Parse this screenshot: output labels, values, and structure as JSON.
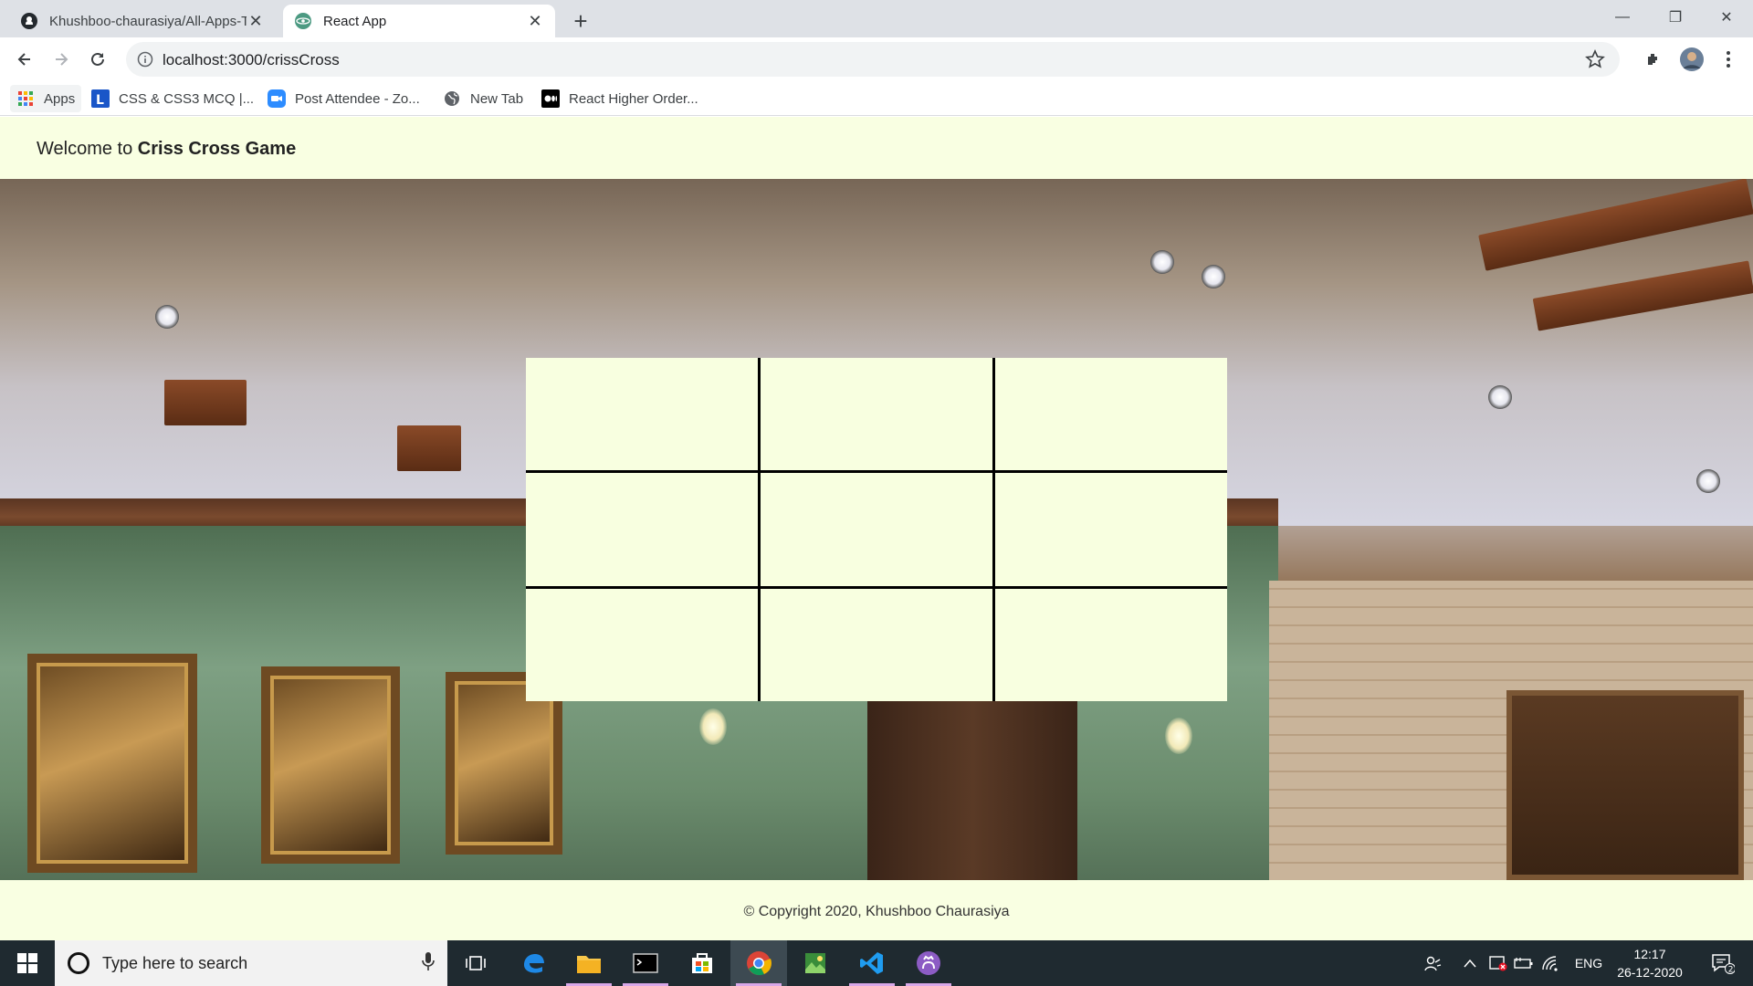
{
  "browser": {
    "tabs": [
      {
        "title": "Khushboo-chaurasiya/All-Apps-T",
        "favicon": "github-icon",
        "active": false
      },
      {
        "title": "React App",
        "favicon": "react-icon",
        "active": true
      }
    ],
    "url": "localhost:3000/crissCross",
    "bookmarks": [
      {
        "label": "Apps",
        "icon": "apps-grid-icon"
      },
      {
        "label": "CSS & CSS3 MCQ |...",
        "icon": "l-logo-icon"
      },
      {
        "label": "Post Attendee - Zo...",
        "icon": "zoom-icon"
      },
      {
        "label": "New Tab",
        "icon": "globe-icon"
      },
      {
        "label": "React Higher Order...",
        "icon": "medium-icon"
      }
    ]
  },
  "page": {
    "welcome_prefix": "Welcome to ",
    "welcome_title": "Criss Cross Game",
    "board": {
      "rows": 3,
      "cols": 3,
      "cells": [
        "",
        "",
        "",
        "",
        "",
        "",
        "",
        "",
        ""
      ]
    },
    "footer": "© Copyright 2020, Khushboo Chaurasiya"
  },
  "taskbar": {
    "search_placeholder": "Type here to search",
    "language": "ENG",
    "time": "12:17",
    "date": "26-12-2020",
    "notification_count": "2",
    "accent": "#d8a7e8"
  }
}
